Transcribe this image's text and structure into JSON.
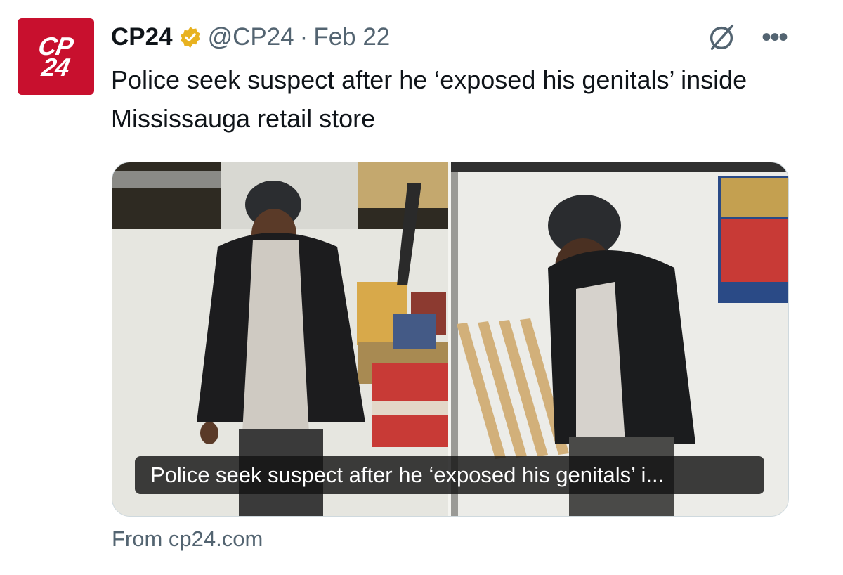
{
  "account": {
    "avatar_line1": "CP",
    "avatar_line2": "24",
    "name": "CP24",
    "handle": "@CP24",
    "separator": "·",
    "date": "Feb 22"
  },
  "icons": {
    "verified": "verified-badge-icon",
    "grok": "grok-icon",
    "more": "more-icon",
    "more_glyph": "•••"
  },
  "tweet": {
    "text": "Police seek suspect after he ‘exposed his genitals’ inside Mississauga retail store"
  },
  "card": {
    "caption": "Police seek suspect after he ‘exposed his genitals’ i...",
    "source": "From cp24.com"
  },
  "colors": {
    "brand_red": "#c8102e",
    "verified_gold": "#e8b220",
    "secondary_text": "#536471"
  }
}
